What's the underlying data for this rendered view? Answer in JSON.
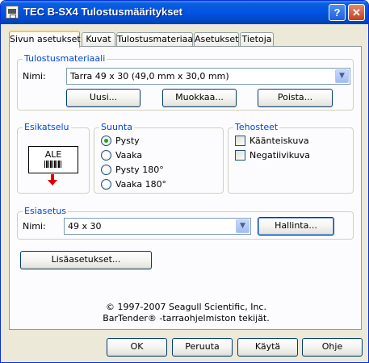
{
  "window": {
    "title": "TEC B-SX4 Tulostusmääritykset"
  },
  "tabs": [
    {
      "label": "Sivun asetukset",
      "active": true
    },
    {
      "label": "Kuvat",
      "active": false
    },
    {
      "label": "Tulostusmateriaali",
      "active": false
    },
    {
      "label": "Asetukset",
      "active": false
    },
    {
      "label": "Tietoja",
      "active": false
    }
  ],
  "media": {
    "group_title": "Tulostusmateriaali",
    "name_label": "Nimi:",
    "name_value": "Tarra 49 x 30 (49,0 mm x 30,0 mm)",
    "new_button": "Uusi...",
    "edit_button": "Muokkaa...",
    "delete_button": "Poista..."
  },
  "preview": {
    "group_title": "Esikatselu",
    "label_text": "ALE"
  },
  "orientation": {
    "group_title": "Suunta",
    "options": [
      "Pysty",
      "Vaaka",
      "Pysty 180°",
      "Vaaka 180°"
    ],
    "selected": "Pysty"
  },
  "effects": {
    "group_title": "Tehosteet",
    "options": [
      "Käänteiskuva",
      "Negatiivikuva"
    ]
  },
  "preset": {
    "group_title": "Esiasetus",
    "name_label": "Nimi:",
    "name_value": "49 x 30",
    "manage_button": "Hallinta..."
  },
  "more_settings_button": "Lisäasetukset...",
  "copyright": {
    "line1": "© 1997-2007 Seagull Scientific, Inc.",
    "line2": "BarTender® -tarraohjelmiston tekijät."
  },
  "footer": {
    "ok": "OK",
    "cancel": "Peruuta",
    "apply": "Käytä",
    "help": "Ohje"
  },
  "colors": {
    "titlebar": "#0054e3",
    "group_title": "#0046d5",
    "dialog_bg": "#ece9d8",
    "panel_bg": "#fcfcfe",
    "active_tab_accent": "#ffc83c"
  }
}
